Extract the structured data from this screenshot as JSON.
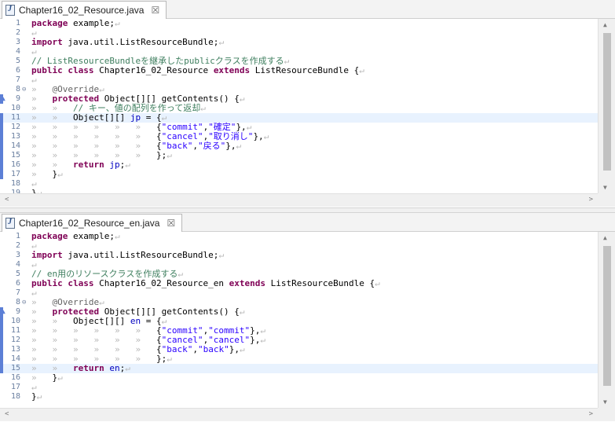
{
  "pane1": {
    "tab": {
      "title": "Chapter16_02_Resource.java",
      "close": "☒"
    },
    "lines": [
      {
        "n": "1",
        "html": "<span class='kw'>package</span> example;<span class='ws'>↵</span>"
      },
      {
        "n": "2",
        "html": "<span class='ws'>↵</span>"
      },
      {
        "n": "3",
        "html": "<span class='kw'>import</span> java.util.ListResourceBundle;<span class='ws'>↵</span>"
      },
      {
        "n": "4",
        "html": "<span class='ws'>↵</span>"
      },
      {
        "n": "5",
        "html": "<span class='cm'>// ListResourceBundleを継承したpublicクラスを作成する</span><span class='ws'>↵</span>"
      },
      {
        "n": "6",
        "html": "<span class='kw'>public class</span> Chapter16_02_Resource <span class='kw'>extends</span> ListResourceBundle {<span class='ws'>↵</span>"
      },
      {
        "n": "7",
        "html": "<span class='ws'>↵</span>"
      },
      {
        "n": "8",
        "html": "<span class='lead'>»   </span><span class='an'>@Override</span><span class='ws'>↵</span>",
        "fold": "⊖"
      },
      {
        "n": "9",
        "html": "<span class='lead'>»   </span><span class='kw'>protected</span> Object[][] getContents() {<span class='ws'>↵</span>",
        "up": true
      },
      {
        "n": "10",
        "html": "<span class='lead'>»   »   </span><span class='cm'>// キー、値の配列を作って返却</span><span class='ws'>↵</span>"
      },
      {
        "n": "11",
        "html": "<span class='lead'>»   »   </span>Object[][] <span class='fld'>jp</span> = {<span class='ws'>↵</span>",
        "hl": true
      },
      {
        "n": "12",
        "html": "<span class='lead'>»   »   »   »   »   »   </span>{<span class='st'>\"commit\"</span>,<span class='st'>\"確定\"</span>},<span class='ws'>↵</span>"
      },
      {
        "n": "13",
        "html": "<span class='lead'>»   »   »   »   »   »   </span>{<span class='st'>\"cancel\"</span>,<span class='st'>\"取り消し\"</span>},<span class='ws'>↵</span>"
      },
      {
        "n": "14",
        "html": "<span class='lead'>»   »   »   »   »   »   </span>{<span class='st'>\"back\"</span>,<span class='st'>\"戻る\"</span>},<span class='ws'>↵</span>"
      },
      {
        "n": "15",
        "html": "<span class='lead'>»   »   »   »   »   »   </span>};<span class='ws'>↵</span>"
      },
      {
        "n": "16",
        "html": "<span class='lead'>»   »   </span><span class='kw'>return</span> <span class='fld'>jp</span>;<span class='ws'>↵</span>"
      },
      {
        "n": "17",
        "html": "<span class='lead'>»   </span>}<span class='ws'>↵</span>"
      },
      {
        "n": "18",
        "html": "<span class='ws'>↵</span>"
      },
      {
        "n": "19",
        "html": "}<span class='ws'>↵</span>"
      }
    ],
    "markers": [
      {
        "line": 9,
        "color": "#5c7fd6"
      },
      {
        "line": 11,
        "color": "#5c7fd6"
      },
      {
        "line": 12,
        "color": "#5c7fd6"
      },
      {
        "line": 13,
        "color": "#5c7fd6"
      },
      {
        "line": 14,
        "color": "#5c7fd6"
      },
      {
        "line": 15,
        "color": "#5c7fd6"
      },
      {
        "line": 16,
        "color": "#5c7fd6"
      },
      {
        "line": 17,
        "color": "#5c7fd6"
      }
    ]
  },
  "pane2": {
    "tab": {
      "title": "Chapter16_02_Resource_en.java",
      "close": "☒"
    },
    "lines": [
      {
        "n": "1",
        "html": "<span class='kw'>package</span> example;<span class='ws'>↵</span>"
      },
      {
        "n": "2",
        "html": "<span class='ws'>↵</span>"
      },
      {
        "n": "3",
        "html": "<span class='kw'>import</span> java.util.ListResourceBundle;<span class='ws'>↵</span>"
      },
      {
        "n": "4",
        "html": "<span class='ws'>↵</span>"
      },
      {
        "n": "5",
        "html": "<span class='cm'>// en用のリソースクラスを作成する</span><span class='ws'>↵</span>"
      },
      {
        "n": "6",
        "html": "<span class='kw'>public class</span> Chapter16_02_Resource_en <span class='kw'>extends</span> ListResourceBundle {<span class='ws'>↵</span>"
      },
      {
        "n": "7",
        "html": "<span class='ws'>↵</span>"
      },
      {
        "n": "8",
        "html": "<span class='lead'>»   </span><span class='an'>@Override</span><span class='ws'>↵</span>",
        "fold": "⊖"
      },
      {
        "n": "9",
        "html": "<span class='lead'>»   </span><span class='kw'>protected</span> Object[][] getContents() {<span class='ws'>↵</span>",
        "up": true
      },
      {
        "n": "10",
        "html": "<span class='lead'>»   »   </span>Object[][] <span class='fld'>en</span> = {<span class='ws'>↵</span>"
      },
      {
        "n": "11",
        "html": "<span class='lead'>»   »   »   »   »   »   </span>{<span class='st'>\"commit\"</span>,<span class='st'>\"commit\"</span>},<span class='ws'>↵</span>"
      },
      {
        "n": "12",
        "html": "<span class='lead'>»   »   »   »   »   »   </span>{<span class='st'>\"cancel\"</span>,<span class='st'>\"cancel\"</span>},<span class='ws'>↵</span>"
      },
      {
        "n": "13",
        "html": "<span class='lead'>»   »   »   »   »   »   </span>{<span class='st'>\"back\"</span>,<span class='st'>\"back\"</span>},<span class='ws'>↵</span>"
      },
      {
        "n": "14",
        "html": "<span class='lead'>»   »   »   »   »   »   </span>};<span class='ws'>↵</span>"
      },
      {
        "n": "15",
        "html": "<span class='lead'>»   »   </span><span class='kw'>return</span> <span class='fld'>en</span>;<span class='ws'>↵</span>",
        "hl": true
      },
      {
        "n": "16",
        "html": "<span class='lead'>»   </span>}<span class='ws'>↵</span>"
      },
      {
        "n": "17",
        "html": "<span class='ws'>↵</span>"
      },
      {
        "n": "18",
        "html": "}<span class='ws'>↵</span>"
      }
    ],
    "markers": [
      {
        "line": 9,
        "color": "#5c7fd6"
      },
      {
        "line": 10,
        "color": "#5c7fd6"
      },
      {
        "line": 11,
        "color": "#5c7fd6"
      },
      {
        "line": 12,
        "color": "#5c7fd6"
      },
      {
        "line": 13,
        "color": "#5c7fd6"
      },
      {
        "line": 14,
        "color": "#5c7fd6"
      },
      {
        "line": 15,
        "color": "#5c7fd6"
      }
    ]
  },
  "icons": {
    "fold": "fold-collapse-icon",
    "override": "override-arrow-icon",
    "file": "java-file-icon"
  }
}
